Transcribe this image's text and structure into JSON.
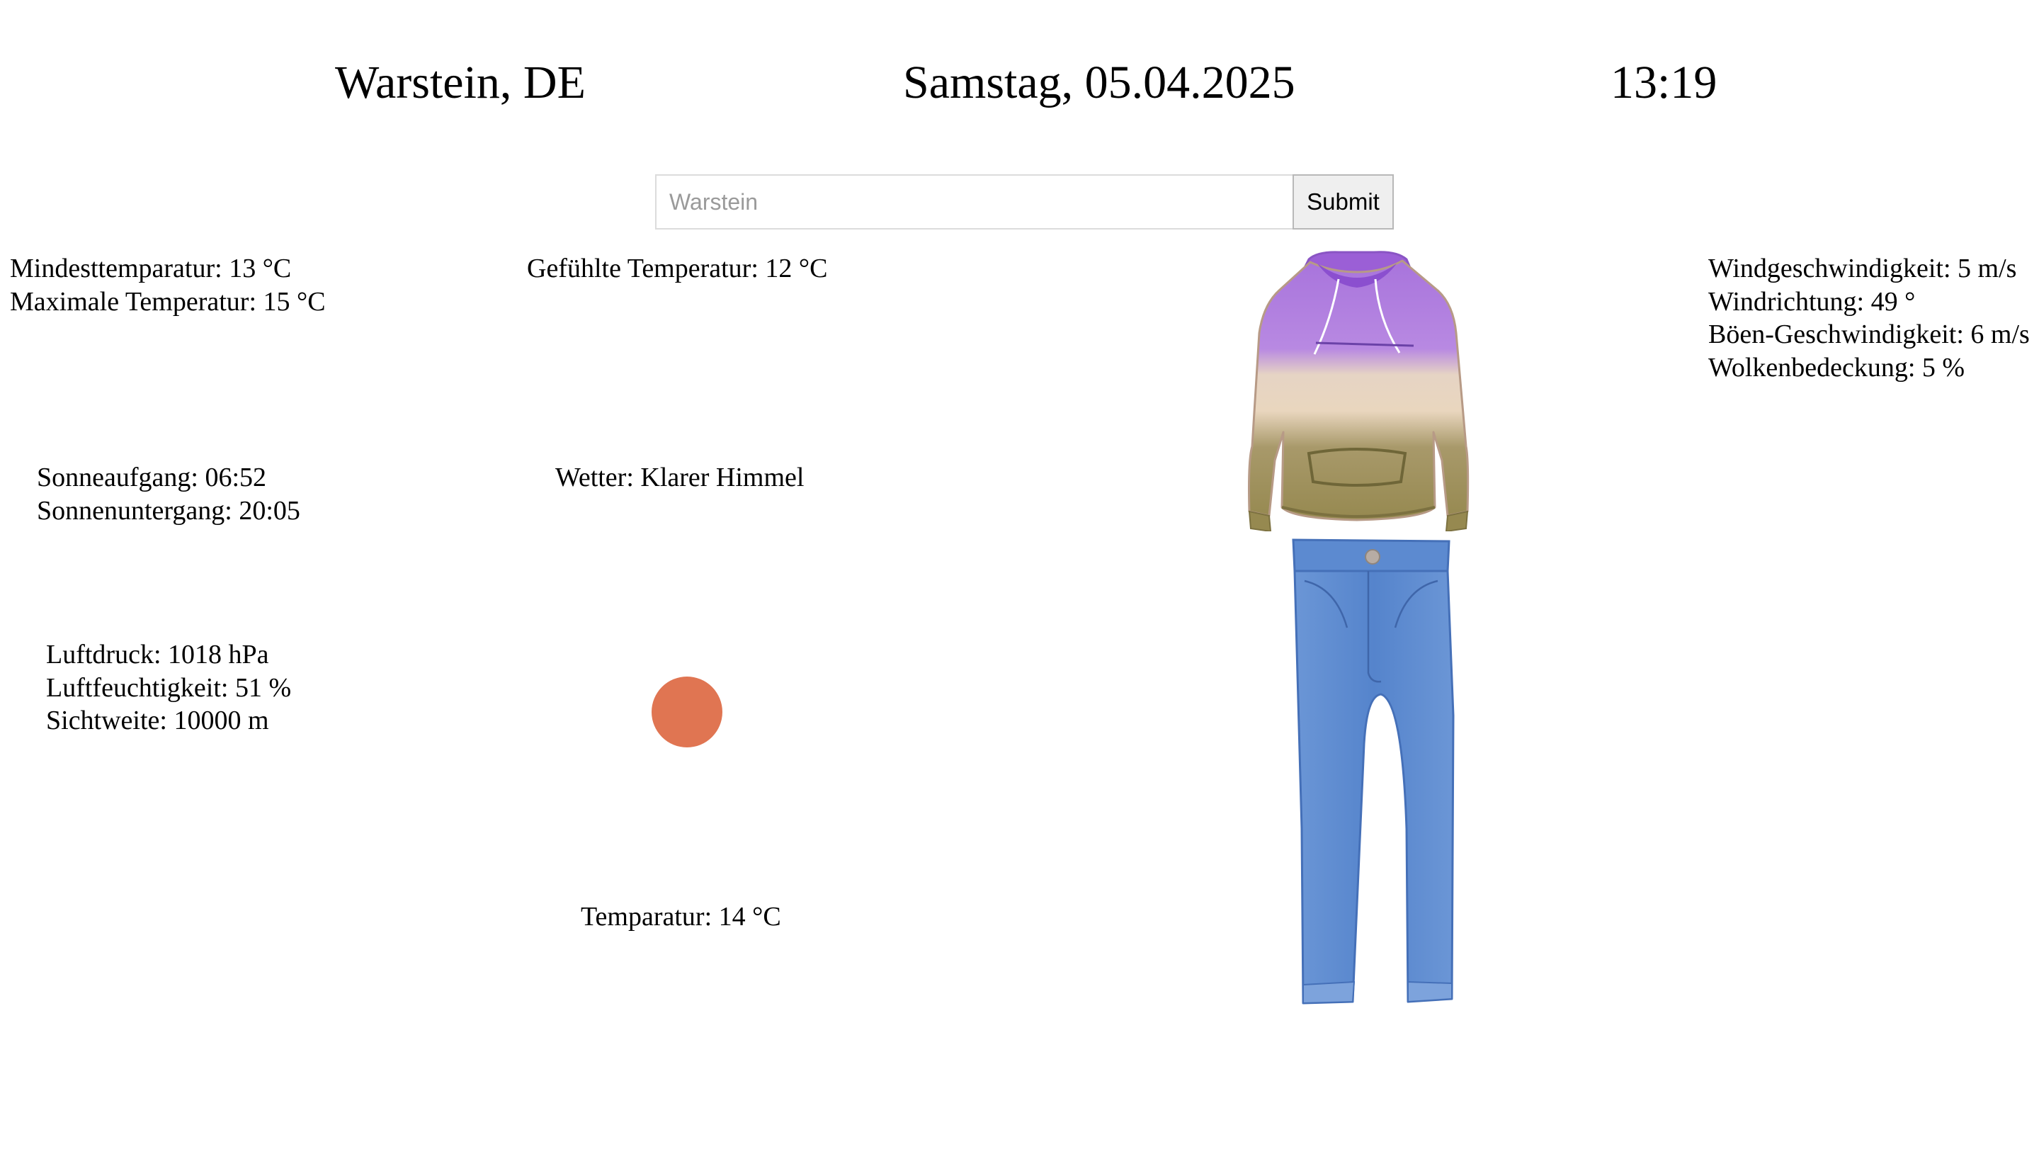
{
  "header": {
    "location": "Warstein, DE",
    "date": "Samstag, 05.04.2025",
    "time": "13:19"
  },
  "search": {
    "placeholder": "Warstein",
    "value": "",
    "submit_label": "Submit"
  },
  "weather": {
    "min_temp": "Mindesttemparatur: 13 °C",
    "max_temp": "Maximale Temperatur: 15 °C",
    "feels_like": "Gefühlte Temperatur: 12 °C",
    "sunrise": "Sonneaufgang: 06:52",
    "sunset": "Sonnenuntergang: 20:05",
    "description": "Wetter: Klarer Himmel",
    "pressure": "Luftdruck: 1018 hPa",
    "humidity": "Luftfeuchtigkeit: 51 %",
    "visibility": "Sichtweite: 10000 m",
    "temperature": "Temparatur: 14 °C",
    "wind_speed": "Windgeschwindigkeit: 5 m/s",
    "wind_direction": "Windrichtung: 49 °",
    "gust_speed": "Böen-Geschwindigkeit: 6 m/s",
    "cloud_cover": "Wolkenbedeckung: 5 %",
    "icon": "sun-icon",
    "icon_color": "#e07552"
  },
  "outfit": {
    "top": "hoodie",
    "bottom": "jeans",
    "colors": {
      "hoodie_top": "#b07be0",
      "hoodie_middle": "#e8d6c2",
      "hoodie_bottom": "#9a8c52",
      "jeans": "#5a86cc"
    }
  }
}
